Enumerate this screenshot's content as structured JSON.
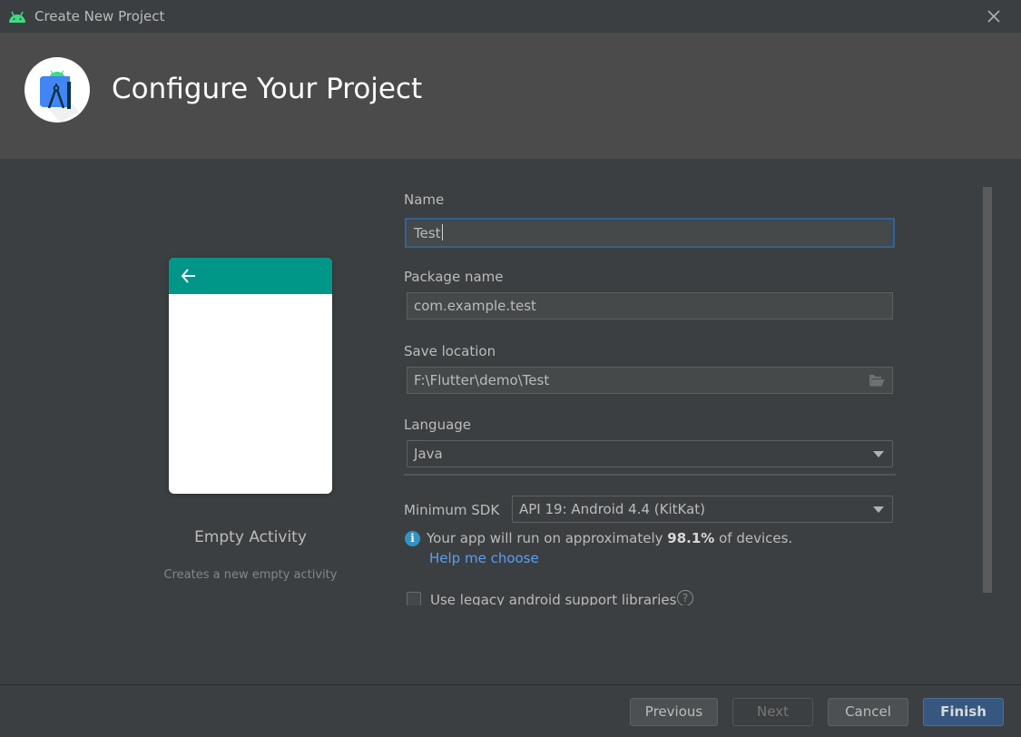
{
  "window": {
    "title": "Create New Project",
    "app_icon": "android-icon",
    "close_icon": "close-icon"
  },
  "header": {
    "title": "Configure Your Project",
    "logo": "android-studio-logo"
  },
  "template": {
    "name": "Empty Activity",
    "description": "Creates a new empty activity",
    "preview_appbar_color": "#009688",
    "back_icon": "arrow-back-icon"
  },
  "form": {
    "name": {
      "label": "Name",
      "value": "Test"
    },
    "package_name": {
      "label": "Package name",
      "value": "com.example.test"
    },
    "save_location": {
      "label": "Save location",
      "value": "F:\\Flutter\\demo\\Test",
      "icon": "folder-open-icon"
    },
    "language": {
      "label": "Language",
      "selected": "Java"
    },
    "minimum_sdk": {
      "label": "Minimum SDK",
      "selected": "API 19: Android 4.4 (KitKat)"
    },
    "info": {
      "prefix": "Your app will run on approximately ",
      "percent": "98.1%",
      "suffix": " of devices.",
      "help_link": "Help me choose"
    },
    "legacy_support": {
      "label": "Use legacy android support libraries",
      "checked": false,
      "help_icon": "?"
    }
  },
  "buttons": {
    "previous": "Previous",
    "next": "Next",
    "cancel": "Cancel",
    "finish": "Finish"
  },
  "colors": {
    "accent": "#365880",
    "link": "#589df6",
    "info": "#3592c4",
    "focus_border": "#3d6185"
  }
}
